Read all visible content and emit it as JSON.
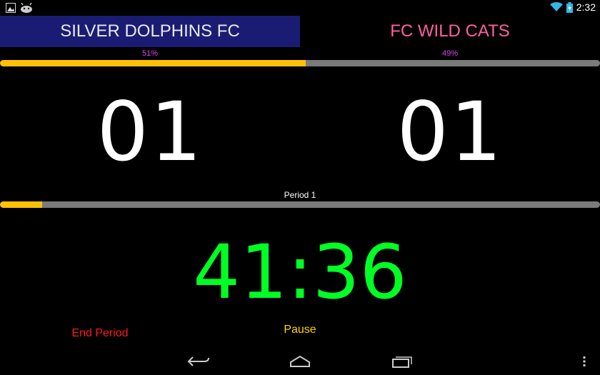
{
  "status_bar": {
    "time": "2:32",
    "icons": [
      "gallery-icon",
      "android-icon",
      "wifi-icon",
      "battery-charging-icon"
    ]
  },
  "teams": {
    "home": {
      "name": "SILVER DOLPHINS FC",
      "possession": "51%",
      "score": "01"
    },
    "away": {
      "name": "FC WILD CATS",
      "possession": "49%",
      "score": "01"
    }
  },
  "possession_bar": {
    "home_fraction": 0.51
  },
  "period": {
    "label": "Period 1",
    "progress_fraction": 0.07
  },
  "clock": {
    "time": "41:36"
  },
  "controls": {
    "end_period_label": "End Period",
    "pause_label": "Pause"
  },
  "nav_bar": {
    "icons": [
      "back-icon",
      "home-icon",
      "recent-apps-icon",
      "overflow-menu-icon"
    ]
  },
  "colors": {
    "home_bg": "#1a1c74",
    "away_text": "#ff5fa2",
    "percent_text": "#e040fb",
    "bar_fill": "#ffc107",
    "bar_track": "#7a7a7a",
    "clock": "#00ff22",
    "end_period": "#ff1a1a",
    "pause": "#ffd400"
  }
}
